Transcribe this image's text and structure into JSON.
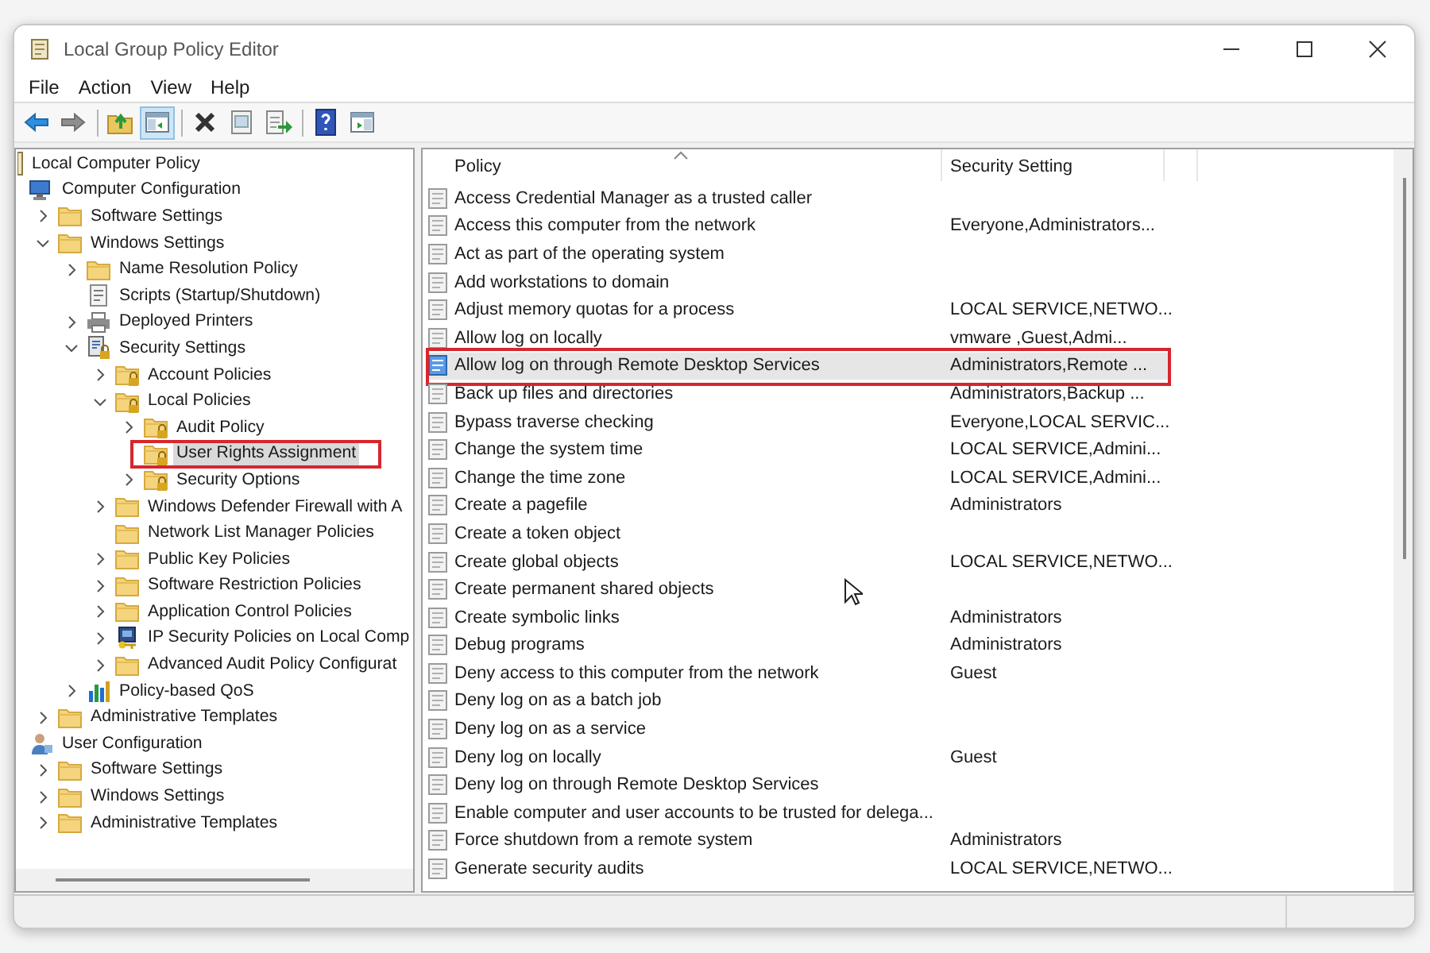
{
  "window": {
    "title": "Local Group Policy Editor"
  },
  "menu": [
    "File",
    "Action",
    "View",
    "Help"
  ],
  "toolbar": [
    {
      "kind": "back",
      "on": false
    },
    {
      "kind": "forward",
      "on": false
    },
    {
      "kind": "separator"
    },
    {
      "kind": "up",
      "on": false
    },
    {
      "kind": "tree",
      "on": true
    },
    {
      "kind": "separator"
    },
    {
      "kind": "delete",
      "on": false
    },
    {
      "kind": "properties",
      "on": false
    },
    {
      "kind": "export",
      "on": false
    },
    {
      "kind": "separator"
    },
    {
      "kind": "help",
      "on": false
    },
    {
      "kind": "view",
      "on": false
    }
  ],
  "tree": [
    {
      "label": "Local Computer Policy",
      "kind": "root",
      "selected": false,
      "highlighted": false,
      "children": [
        {
          "label": "Computer Configuration",
          "kind": "computer",
          "selected": false,
          "highlighted": false,
          "children": [
            {
              "label": "Software Settings",
              "kind": "folder",
              "expanded": false,
              "selected": false,
              "highlighted": false
            },
            {
              "label": "Windows Settings",
              "kind": "folder",
              "expanded": true,
              "selected": false,
              "highlighted": false,
              "children": [
                {
                  "label": "Name Resolution Policy",
                  "kind": "folder",
                  "expanded": false,
                  "selected": false,
                  "highlighted": false
                },
                {
                  "label": "Scripts (Startup/Shutdown)",
                  "kind": "scripts",
                  "selected": false,
                  "highlighted": false
                },
                {
                  "label": "Deployed Printers",
                  "kind": "printer",
                  "expanded": false,
                  "selected": false,
                  "highlighted": false
                },
                {
                  "label": "Security Settings",
                  "kind": "security",
                  "expanded": true,
                  "selected": false,
                  "highlighted": false,
                  "children": [
                    {
                      "label": "Account Policies",
                      "kind": "secure-folder",
                      "expanded": false,
                      "selected": false,
                      "highlighted": false
                    },
                    {
                      "label": "Local Policies",
                      "kind": "secure-folder",
                      "expanded": true,
                      "selected": false,
                      "highlighted": false,
                      "children": [
                        {
                          "label": "Audit Policy",
                          "kind": "secure-folder",
                          "expanded": false,
                          "selected": false,
                          "highlighted": false
                        },
                        {
                          "label": "User Rights Assignment",
                          "kind": "secure-folder",
                          "selected": true,
                          "highlighted": true
                        },
                        {
                          "label": "Security Options",
                          "kind": "secure-folder",
                          "expanded": false,
                          "selected": false,
                          "highlighted": false
                        }
                      ]
                    },
                    {
                      "label": "Windows Defender Firewall with A",
                      "kind": "folder",
                      "expanded": false,
                      "selected": false,
                      "highlighted": false
                    },
                    {
                      "label": "Network List Manager Policies",
                      "kind": "folder",
                      "selected": false,
                      "highlighted": false
                    },
                    {
                      "label": "Public Key Policies",
                      "kind": "folder",
                      "expanded": false,
                      "selected": false,
                      "highlighted": false
                    },
                    {
                      "label": "Software Restriction Policies",
                      "kind": "folder",
                      "expanded": false,
                      "selected": false,
                      "highlighted": false
                    },
                    {
                      "label": "Application Control Policies",
                      "kind": "folder",
                      "expanded": false,
                      "selected": false,
                      "highlighted": false
                    },
                    {
                      "label": "IP Security Policies on Local Comp",
                      "kind": "ipsec",
                      "expanded": false,
                      "selected": false,
                      "highlighted": false
                    },
                    {
                      "label": "Advanced Audit Policy Configurat",
                      "kind": "folder",
                      "expanded": false,
                      "selected": false,
                      "highlighted": false
                    }
                  ]
                },
                {
                  "label": "Policy-based QoS",
                  "kind": "qos",
                  "expanded": false,
                  "selected": false,
                  "highlighted": false
                }
              ]
            },
            {
              "label": "Administrative Templates",
              "kind": "folder",
              "expanded": false,
              "selected": false,
              "highlighted": false
            }
          ]
        },
        {
          "label": "User Configuration",
          "kind": "user",
          "selected": false,
          "highlighted": false,
          "children": [
            {
              "label": "Software Settings",
              "kind": "folder",
              "expanded": false,
              "selected": false,
              "highlighted": false
            },
            {
              "label": "Windows Settings",
              "kind": "folder",
              "expanded": false,
              "selected": false,
              "highlighted": false
            },
            {
              "label": "Administrative Templates",
              "kind": "folder",
              "expanded": false,
              "selected": false,
              "highlighted": false
            }
          ]
        }
      ]
    }
  ],
  "table": {
    "columns": [
      "Policy",
      "Security Setting"
    ],
    "rows": [
      {
        "policy": "Access Credential Manager as a trusted caller",
        "setting": "",
        "selected": false,
        "highlighted": false
      },
      {
        "policy": "Access this computer from the network",
        "setting": "Everyone,Administrators...",
        "selected": false,
        "highlighted": false
      },
      {
        "policy": "Act as part of the operating system",
        "setting": "",
        "selected": false,
        "highlighted": false
      },
      {
        "policy": "Add workstations to domain",
        "setting": "",
        "selected": false,
        "highlighted": false
      },
      {
        "policy": "Adjust memory quotas for a process",
        "setting": "LOCAL SERVICE,NETWO...",
        "selected": false,
        "highlighted": false
      },
      {
        "policy": "Allow log on locally",
        "setting": "vmware ,Guest,Admi...",
        "selected": false,
        "highlighted": false
      },
      {
        "policy": "Allow log on through Remote Desktop Services",
        "setting": "Administrators,Remote ...",
        "selected": true,
        "highlighted": true
      },
      {
        "policy": "Back up files and directories",
        "setting": "Administrators,Backup ...",
        "selected": false,
        "highlighted": false
      },
      {
        "policy": "Bypass traverse checking",
        "setting": "Everyone,LOCAL SERVIC...",
        "selected": false,
        "highlighted": false
      },
      {
        "policy": "Change the system time",
        "setting": "LOCAL SERVICE,Admini...",
        "selected": false,
        "highlighted": false
      },
      {
        "policy": "Change the time zone",
        "setting": "LOCAL SERVICE,Admini...",
        "selected": false,
        "highlighted": false
      },
      {
        "policy": "Create a pagefile",
        "setting": "Administrators",
        "selected": false,
        "highlighted": false
      },
      {
        "policy": "Create a token object",
        "setting": "",
        "selected": false,
        "highlighted": false
      },
      {
        "policy": "Create global objects",
        "setting": "LOCAL SERVICE,NETWO...",
        "selected": false,
        "highlighted": false
      },
      {
        "policy": "Create permanent shared objects",
        "setting": "",
        "selected": false,
        "highlighted": false
      },
      {
        "policy": "Create symbolic links",
        "setting": "Administrators",
        "selected": false,
        "highlighted": false
      },
      {
        "policy": "Debug programs",
        "setting": "Administrators",
        "selected": false,
        "highlighted": false
      },
      {
        "policy": "Deny access to this computer from the network",
        "setting": "Guest",
        "selected": false,
        "highlighted": false
      },
      {
        "policy": "Deny log on as a batch job",
        "setting": "",
        "selected": false,
        "highlighted": false
      },
      {
        "policy": "Deny log on as a service",
        "setting": "",
        "selected": false,
        "highlighted": false
      },
      {
        "policy": "Deny log on locally",
        "setting": "Guest",
        "selected": false,
        "highlighted": false
      },
      {
        "policy": "Deny log on through Remote Desktop Services",
        "setting": "",
        "selected": false,
        "highlighted": false
      },
      {
        "policy": "Enable computer and user accounts to be trusted for delega...",
        "setting": "",
        "selected": false,
        "highlighted": false
      },
      {
        "policy": "Force shutdown from a remote system",
        "setting": "Administrators",
        "selected": false,
        "highlighted": false
      },
      {
        "policy": "Generate security audits",
        "setting": "LOCAL SERVICE,NETWO...",
        "selected": false,
        "highlighted": false
      }
    ]
  }
}
